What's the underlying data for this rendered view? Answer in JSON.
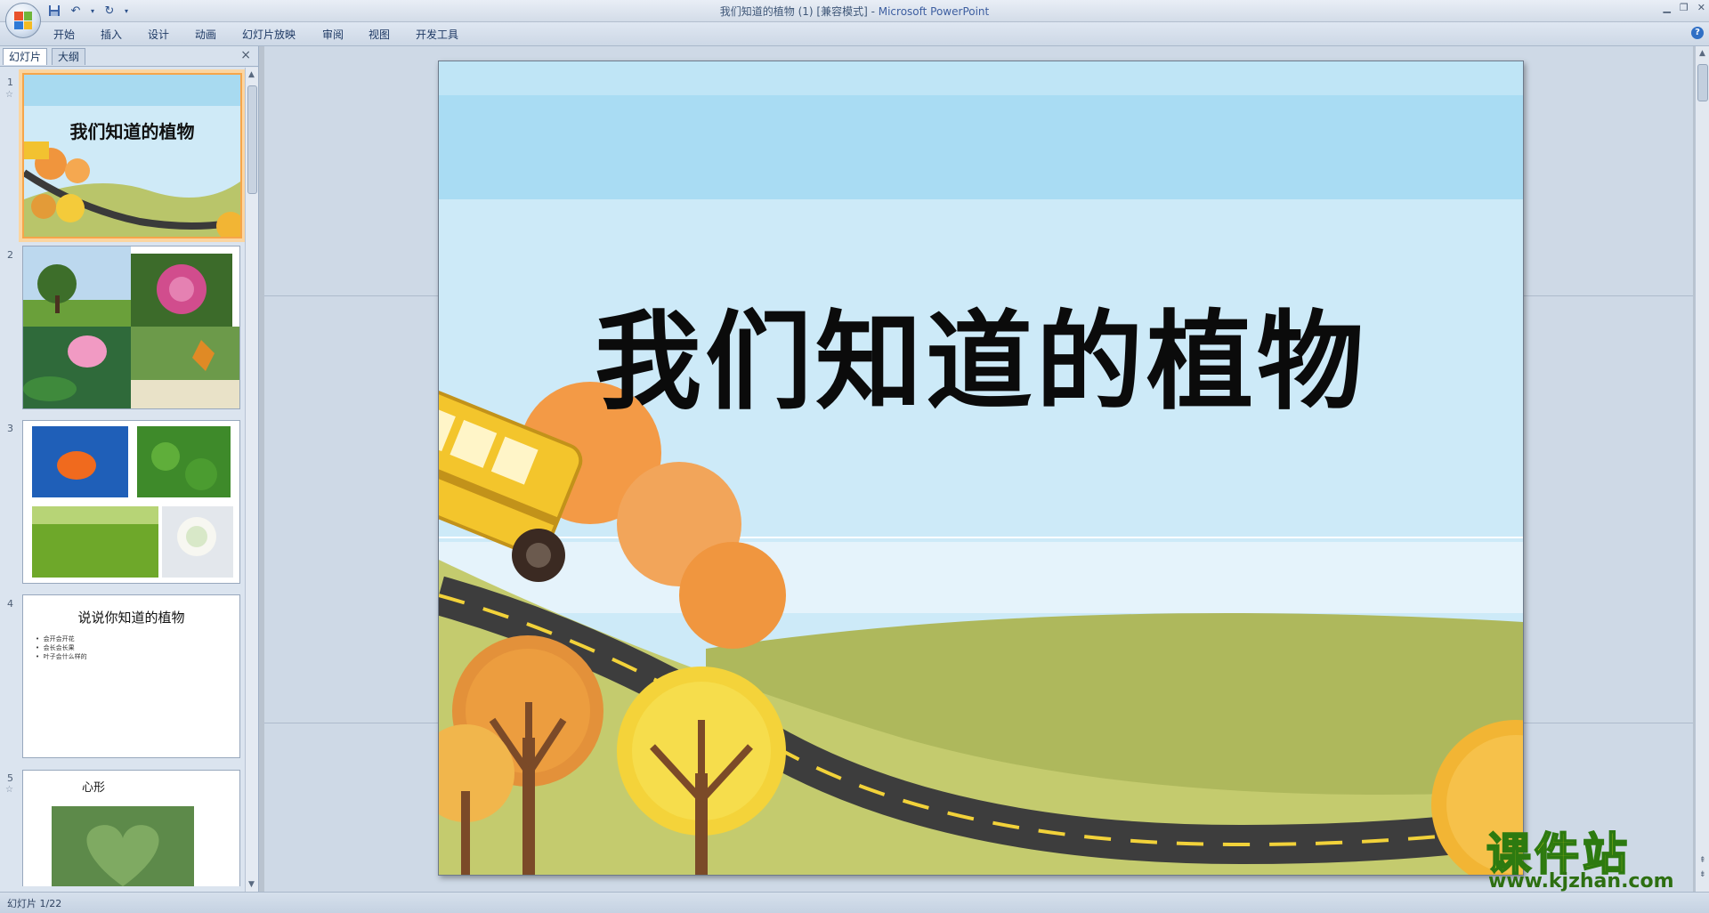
{
  "window": {
    "title": "我们知道的植物 (1) [兼容模式]",
    "separator": " - ",
    "app_name": "Microsoft PowerPoint"
  },
  "ribbon": {
    "tabs": [
      "开始",
      "插入",
      "设计",
      "动画",
      "幻灯片放映",
      "审阅",
      "视图",
      "开发工具"
    ]
  },
  "left_pane": {
    "tabs": [
      "幻灯片",
      "大纲"
    ],
    "close_glyph": "×",
    "slides": [
      {
        "num": "1",
        "title": "我们知道的植物"
      },
      {
        "num": "2"
      },
      {
        "num": "3"
      },
      {
        "num": "4",
        "title": "说说你知道的植物",
        "bullets": [
          "会开会开花",
          "会长会长果",
          "叶子会什么样的"
        ]
      },
      {
        "num": "5",
        "title": "心形"
      }
    ]
  },
  "slide": {
    "title": "我们知道的植物"
  },
  "status": {
    "slide_counter": "幻灯片 1/22"
  },
  "watermark": {
    "top": "课件站",
    "bottom": "www.kjzhan.com"
  }
}
